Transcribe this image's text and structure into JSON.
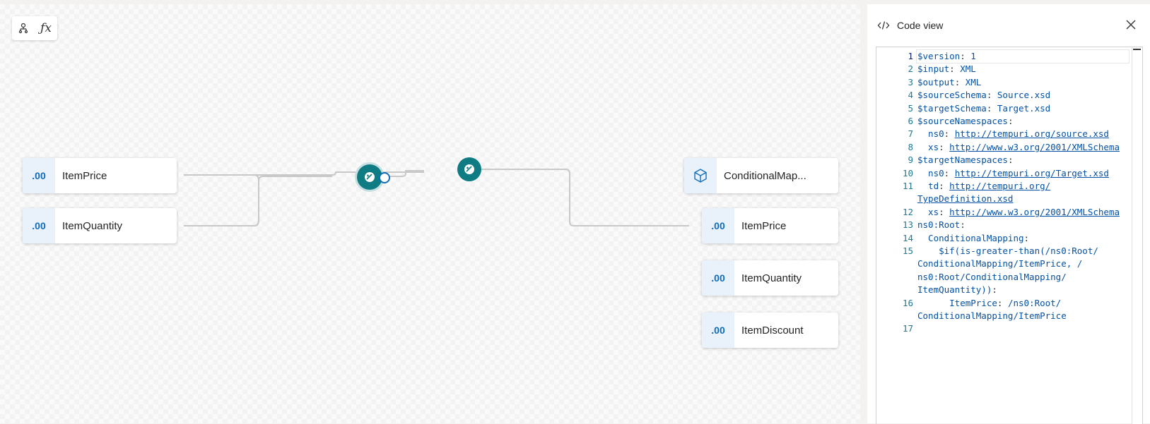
{
  "toolbar": {
    "icons": [
      "schema-tree-icon",
      "function-icon"
    ],
    "fx_label": "ƒx"
  },
  "colors": {
    "accent": "#0f6cbd",
    "function_node": "#0f7b83",
    "badge_bg": "#e9f1fb"
  },
  "source_nodes": [
    {
      "type_badge": ".00",
      "label": "ItemPrice"
    },
    {
      "type_badge": ".00",
      "label": "ItemQuantity"
    }
  ],
  "target_nodes": [
    {
      "type_icon": "cube-icon",
      "label": "ConditionalMap..."
    },
    {
      "type_badge": ".00",
      "label": "ItemPrice"
    },
    {
      "type_badge": ".00",
      "label": "ItemQuantity"
    },
    {
      "type_badge": ".00",
      "label": "ItemDiscount"
    }
  ],
  "functions": [
    {
      "name": "is-greater-than",
      "icon": "compare-icon"
    },
    {
      "name": "if",
      "icon": "compare-icon"
    }
  ],
  "code_panel": {
    "title": "Code view",
    "lines": [
      {
        "n": "1",
        "key": "$version",
        "sep": ": ",
        "val": "1"
      },
      {
        "n": "2",
        "key": "$input",
        "sep": ": ",
        "val": "XML"
      },
      {
        "n": "3",
        "key": "$output",
        "sep": ": ",
        "val": "XML"
      },
      {
        "n": "4",
        "key": "$sourceSchema",
        "sep": ": ",
        "val": "Source.xsd"
      },
      {
        "n": "5",
        "key": "$targetSchema",
        "sep": ": ",
        "val": "Target.xsd"
      },
      {
        "n": "6",
        "key": "$sourceNamespaces",
        "sep": ":",
        "val": ""
      },
      {
        "n": "7",
        "key": "  ns0",
        "sep": ": ",
        "link": "http://tempuri.org/source.xsd"
      },
      {
        "n": "8",
        "key": "  xs",
        "sep": ": ",
        "link": "http://www.w3.org/2001/XMLSchema"
      },
      {
        "n": "9",
        "key": "$targetNamespaces",
        "sep": ":",
        "val": ""
      },
      {
        "n": "10",
        "key": "  ns0",
        "sep": ": ",
        "link": "http://tempuri.org/Target.xsd"
      },
      {
        "n": "11",
        "key": "  td",
        "sep": ": ",
        "link": "http://tempuri.org/"
      },
      {
        "n": "",
        "key": "",
        "sep": "",
        "link": "TypeDefinition.xsd"
      },
      {
        "n": "12",
        "key": "  xs",
        "sep": ": ",
        "link": "http://www.w3.org/2001/XMLSchema"
      },
      {
        "n": "13",
        "key": "ns0:Root",
        "sep": ":",
        "val": ""
      },
      {
        "n": "14",
        "key": "  ConditionalMapping",
        "sep": ":",
        "val": ""
      },
      {
        "n": "15",
        "key": "    $if(is-greater-than(/ns0:Root/",
        "sep": "",
        "val": ""
      },
      {
        "n": "",
        "key": "ConditionalMapping/ItemPrice, /",
        "sep": "",
        "val": ""
      },
      {
        "n": "",
        "key": "ns0:Root/ConditionalMapping/",
        "sep": "",
        "val": ""
      },
      {
        "n": "",
        "key": "ItemQuantity))",
        "sep": ":",
        "val": ""
      },
      {
        "n": "16",
        "key": "      ItemPrice",
        "sep": ": ",
        "val": "/ns0:Root/"
      },
      {
        "n": "",
        "key": "",
        "sep": "",
        "val": "ConditionalMapping/ItemPrice"
      },
      {
        "n": "17",
        "key": "",
        "sep": "",
        "val": ""
      }
    ]
  }
}
